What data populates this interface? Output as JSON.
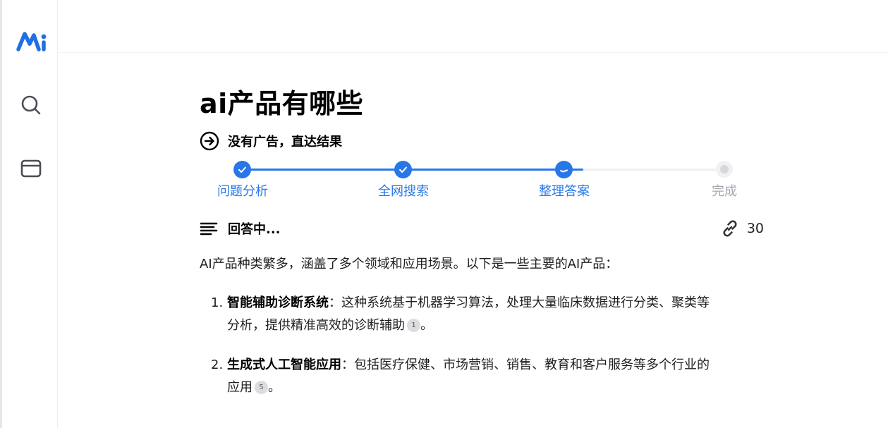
{
  "sidebar": {
    "logo": "Mi-logo",
    "icons": [
      "search-icon",
      "window-icon"
    ]
  },
  "query": {
    "title": "ai产品有哪些",
    "tagline": "没有广告，直达结果"
  },
  "progress": {
    "steps": [
      {
        "label": "问题分析",
        "state": "done"
      },
      {
        "label": "全网搜索",
        "state": "done"
      },
      {
        "label": "整理答案",
        "state": "active"
      },
      {
        "label": "完成",
        "state": "pending"
      }
    ],
    "fraction_complete": 0.71
  },
  "answer": {
    "status": "回答中...",
    "source_count": "30",
    "intro": "AI产品种类繁多，涵盖了多个领域和应用场景。以下是一些主要的AI产品：",
    "items": [
      {
        "number": "1.",
        "heading": "智能辅助诊断系统",
        "colon": "：",
        "line1": "这种系统基于机器学习算法，处理大量临床数据进行分类、聚类等",
        "line2": "分析，提供精准高效的诊断辅助",
        "cite": "1",
        "end": "。"
      },
      {
        "number": "2.",
        "heading": "生成式人工智能应用",
        "colon": "：",
        "line1": "包括医疗保健、市场营销、销售、教育和客户服务等多个行业的",
        "line2": "应用",
        "cite": "5",
        "end": "。"
      }
    ]
  },
  "colors": {
    "accent": "#2777e8",
    "pending": "#a4a8b0"
  }
}
